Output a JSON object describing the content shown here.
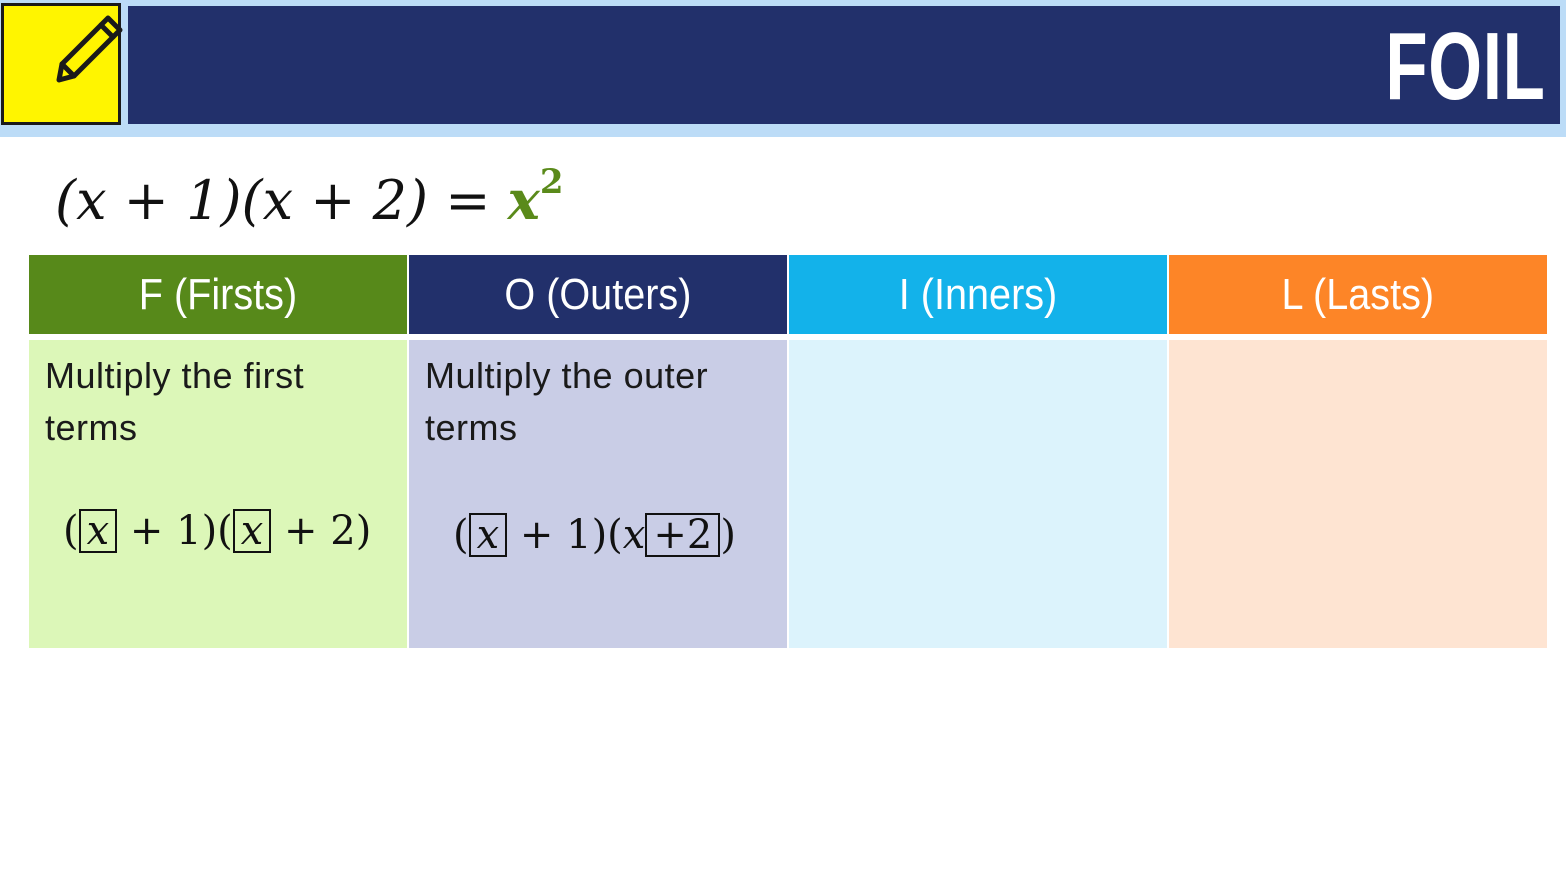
{
  "header": {
    "title": "FOIL",
    "icon": "pencil-icon",
    "colors": {
      "bar": "#22306b",
      "strip": "#bcdcf7",
      "icon_bg": "#fff500"
    }
  },
  "equation": {
    "lhs": "(x + 1)(x + 2) = ",
    "result_base": "x",
    "result_exponent": "2",
    "result_color": "#5a8a1a"
  },
  "columns": [
    {
      "header": "F (Firsts)",
      "header_color": "#57891a",
      "body_color": "#dcf7b8",
      "text": "Multiply the first terms",
      "math": {
        "open": "(",
        "box1": "x",
        "mid1": " + 1)(",
        "box2": "x",
        "mid2": " + 2)"
      }
    },
    {
      "header": "O (Outers)",
      "header_color": "#22306b",
      "body_color": "#c9cde6",
      "text": "Multiply the outer terms",
      "math": {
        "open": "(",
        "box1": "x",
        "mid1": " + 1)(",
        "plain": "x",
        "box2": "+2",
        "close": ")"
      }
    },
    {
      "header": "I (Inners)",
      "header_color": "#13b2ea",
      "body_color": "#dcf3fc",
      "text": "",
      "math": null
    },
    {
      "header": "L (Lasts)",
      "header_color": "#fd8527",
      "body_color": "#fee4d2",
      "text": "",
      "math": null
    }
  ]
}
